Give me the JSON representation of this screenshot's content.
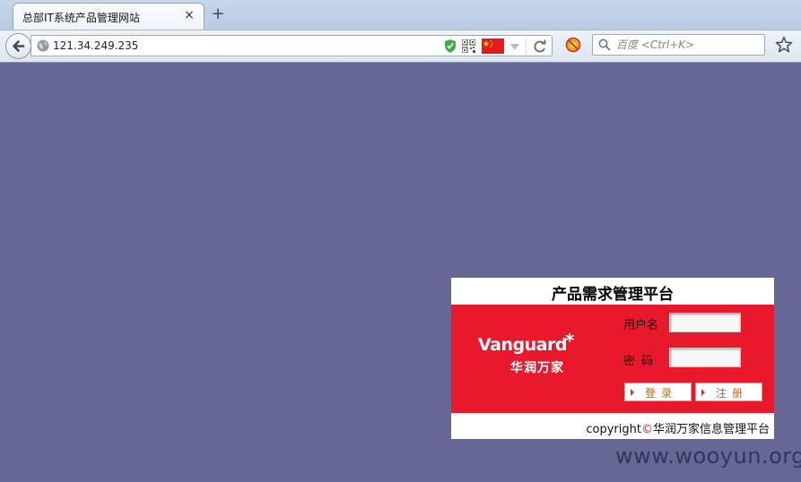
{
  "browser": {
    "tab_title": "总部IT系统产品管理网站",
    "tab_close": "×",
    "new_tab": "+",
    "url": "121.34.249.235",
    "search_placeholder": "百度 <Ctrl+K>"
  },
  "login": {
    "title": "产品需求管理平台",
    "logo_word": "Vanguard",
    "logo_star": "*",
    "logo_cn": "华润万家",
    "username_label": "用户名",
    "password_label": "密码",
    "login_button": "登录",
    "register_button": "注册",
    "copyright_prefix": "copyright",
    "copyright_symbol": "©",
    "copyright_text": "华润万家信息管理平台"
  },
  "watermark": "www.wooyun.org",
  "colors": {
    "page_background": "#666795",
    "brand_red": "#e8192c"
  }
}
